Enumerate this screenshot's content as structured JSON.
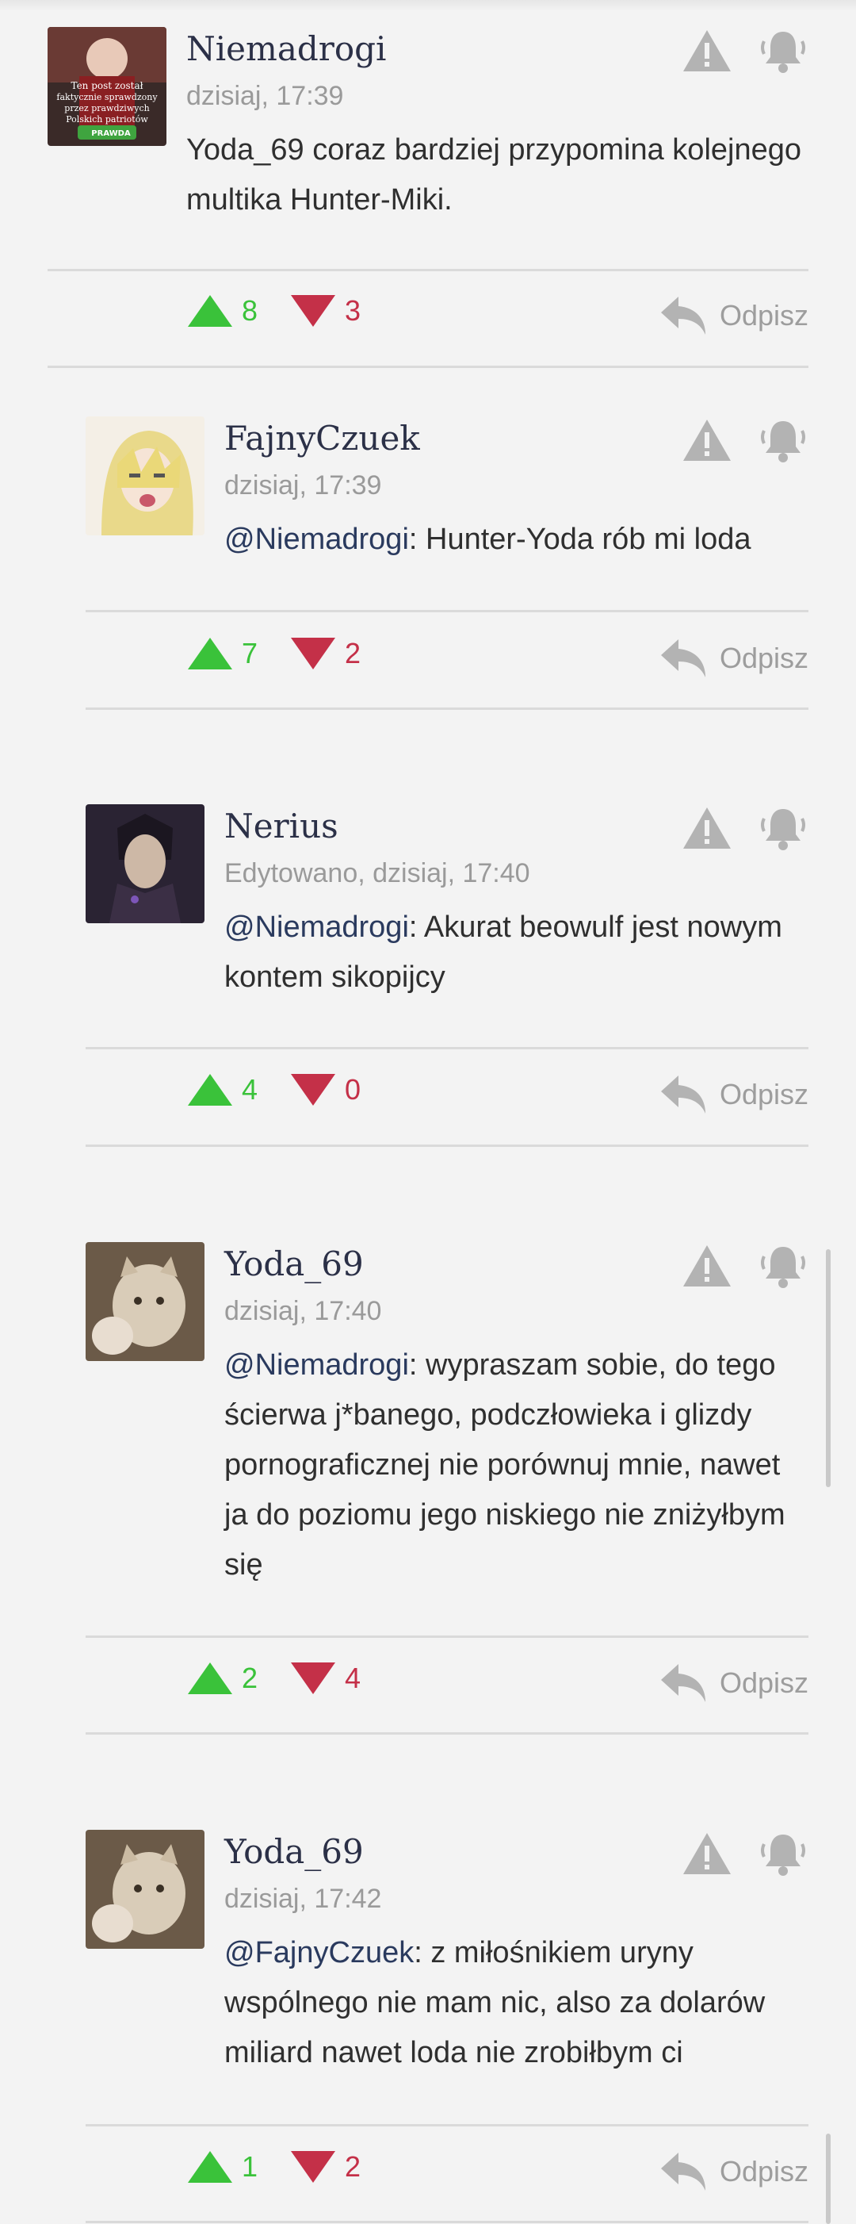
{
  "comments": [
    {
      "author": "Niemadrogi",
      "meta": "dzisiaj, 17:39",
      "mention": "",
      "text": "Yoda_69 coraz bardziej przypomina kolejnego multika Hunter-Miki.",
      "upvotes": "8",
      "downvotes": "3",
      "reply_label": "Odpisz",
      "avatar_text": [
        "Ten post został",
        "faktycznie sprawdzony",
        "przez prawdziwych",
        "Polskich patriotów",
        "PRAWDA"
      ]
    },
    {
      "author": "FajnyCzuek",
      "meta": "dzisiaj, 17:39",
      "mention": "@Niemadrogi",
      "text": ": Hunter-Yoda rób mi loda",
      "upvotes": "7",
      "downvotes": "2",
      "reply_label": "Odpisz"
    },
    {
      "author": "Nerius",
      "meta": "Edytowano, dzisiaj, 17:40",
      "mention": "@Niemadrogi",
      "text": ": Akurat beowulf jest nowym kontem sikopijcy",
      "upvotes": "4",
      "downvotes": "0",
      "reply_label": "Odpisz"
    },
    {
      "author": "Yoda_69",
      "meta": "dzisiaj, 17:40",
      "mention": "@Niemadrogi",
      "text": ": wypraszam sobie, do tego ścierwa j*banego, podczłowieka i glizdy pornograficznej nie porównuj mnie, nawet ja do poziomu jego niskiego nie zniżyłbym się",
      "upvotes": "2",
      "downvotes": "4",
      "reply_label": "Odpisz"
    },
    {
      "author": "Yoda_69",
      "meta": "dzisiaj, 17:42",
      "mention": "@FajnyCzuek",
      "text": ": z miłośnikiem uryny wspólnego nie mam nic, also za dolarów miliard nawet loda nie zrobiłbym ci",
      "upvotes": "1",
      "downvotes": "2",
      "reply_label": "Odpisz"
    }
  ],
  "icons": {
    "report": "warning-icon",
    "notify": "bell-icon",
    "upvote": "triangle-up-icon",
    "downvote": "triangle-down-icon",
    "reply": "reply-arrow-icon"
  },
  "colors": {
    "upvote": "#3ac23a",
    "downvote": "#c43048",
    "author": "#2b3047",
    "meta": "#9a9a9a",
    "icon": "#b3b3b3"
  }
}
